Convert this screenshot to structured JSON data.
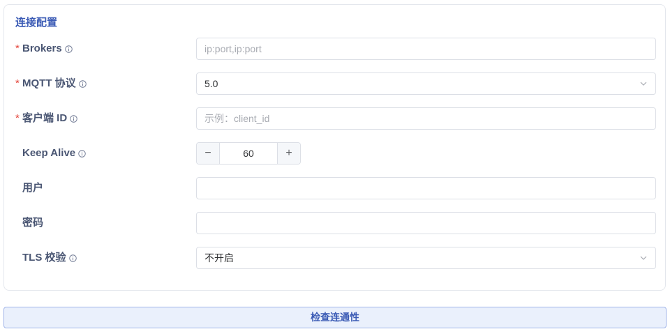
{
  "section": {
    "title": "连接配置"
  },
  "fields": {
    "brokers": {
      "label": "Brokers",
      "required_mark": "*",
      "placeholder": "ip:port,ip:port",
      "value": ""
    },
    "mqtt": {
      "label": "MQTT 协议",
      "required_mark": "*",
      "value": "5.0"
    },
    "client_id": {
      "label": "客户端 ID",
      "required_mark": "*",
      "placeholder": "示例：client_id",
      "value": ""
    },
    "keep_alive": {
      "label": "Keep Alive",
      "value": "60",
      "minus": "−",
      "plus": "+"
    },
    "user": {
      "label": "用户",
      "value": ""
    },
    "password": {
      "label": "密码",
      "value": ""
    },
    "tls": {
      "label": "TLS 校验",
      "value": "不开启"
    }
  },
  "actions": {
    "check_label": "检查连通性"
  },
  "icons": {
    "info": "info-circle-icon",
    "chevron": "chevron-down-icon"
  },
  "colors": {
    "accent": "#3b5bb5",
    "required": "#e5483e",
    "label": "#4a5673",
    "border": "#dcdfe6",
    "button_bg": "#eaf0fc"
  }
}
